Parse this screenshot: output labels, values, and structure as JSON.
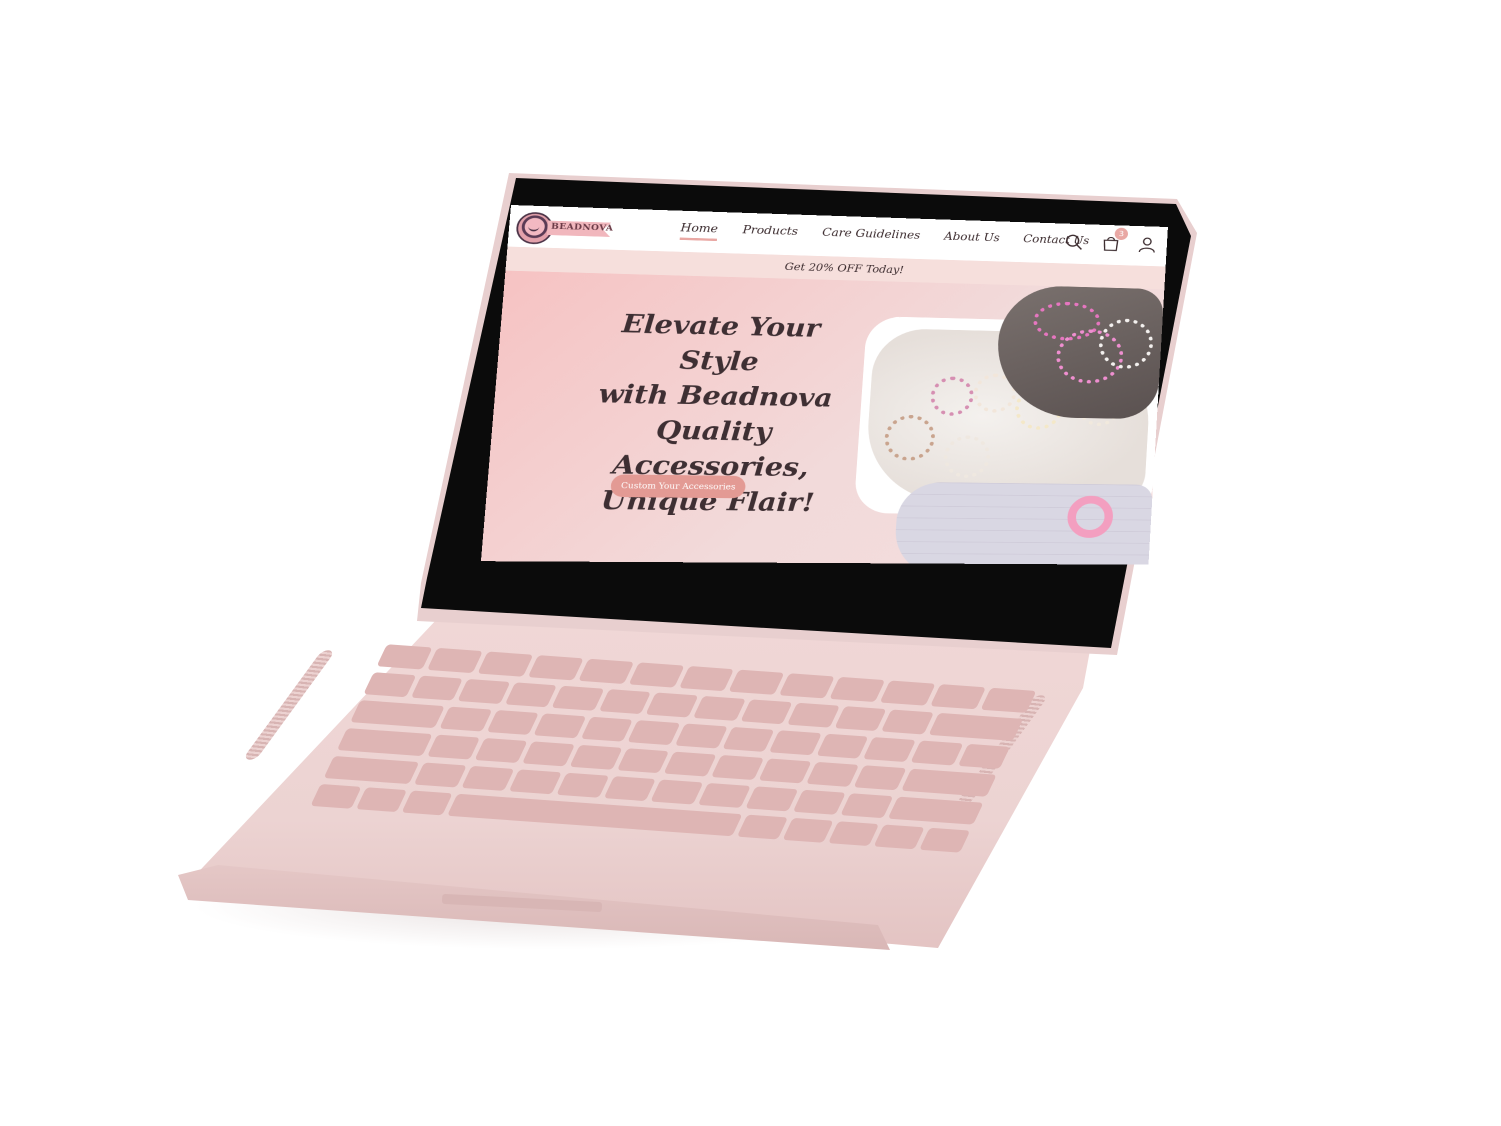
{
  "site": {
    "brand": "BEADNOVA",
    "nav": [
      "Home",
      "Products",
      "Care Guidelines",
      "About Us",
      "Contact Us"
    ],
    "active_nav": "Home",
    "cart_count": "3",
    "promo": "Get 20% OFF Today!",
    "hero": {
      "title_lines": [
        "Elevate Your Style",
        "with Beadnova",
        "Quality Accessories,",
        "Unique Flair!"
      ],
      "cta": "Custom Your Accessories"
    }
  },
  "icons": {
    "search": "search-icon",
    "cart": "shopping-bag-icon",
    "account": "user-icon",
    "logo": "beadnova-logo"
  },
  "colors": {
    "accent": "#e39a94",
    "hero_start": "#f6c3c3",
    "hero_end": "#f4dede",
    "laptop_body": "#ecd3d2",
    "text_dark": "#3e2f33"
  }
}
